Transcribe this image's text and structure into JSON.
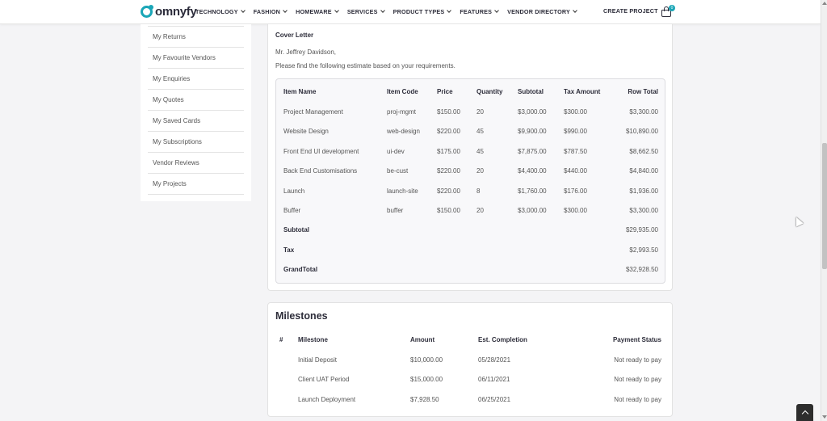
{
  "brand": {
    "name": "omnyfy",
    "accent": "#1aa6b7"
  },
  "nav": {
    "items": [
      "TECHNOLOGY",
      "FASHION",
      "HOMEWARE",
      "SERVICES",
      "PRODUCT TYPES",
      "FEATURES",
      "VENDOR DIRECTORY"
    ],
    "create_project": "CREATE PROJECT",
    "cart_count": "0"
  },
  "sidebar": {
    "items": [
      "My Returns",
      "My Favourite Vendors",
      "My Enquiries",
      "My Quotes",
      "My Saved Cards",
      "My Subscriptions",
      "Vendor Reviews",
      "My Projects"
    ]
  },
  "cover": {
    "title": "Cover Letter",
    "salutation": "Mr. Jeffrey Davidson,",
    "body": "Please find the following estimate based on your requirements."
  },
  "estimate": {
    "headers": [
      "Item Name",
      "Item Code",
      "Price",
      "Quantity",
      "Subtotal",
      "Tax Amount",
      "Row Total"
    ],
    "rows": [
      [
        "Project Management",
        "proj-mgmt",
        "$150.00",
        "20",
        "$3,000.00",
        "$300.00",
        "$3,300.00"
      ],
      [
        "Website Design",
        "web-design",
        "$220.00",
        "45",
        "$9,900.00",
        "$990.00",
        "$10,890.00"
      ],
      [
        "Front End UI development",
        "ui-dev",
        "$175.00",
        "45",
        "$7,875.00",
        "$787.50",
        "$8,662.50"
      ],
      [
        "Back End Customisations",
        "be-cust",
        "$220.00",
        "20",
        "$4,400.00",
        "$440.00",
        "$4,840.00"
      ],
      [
        "Launch",
        "launch-site",
        "$220.00",
        "8",
        "$1,760.00",
        "$176.00",
        "$1,936.00"
      ],
      [
        "Buffer",
        "buffer",
        "$150.00",
        "20",
        "$3,000.00",
        "$300.00",
        "$3,300.00"
      ]
    ],
    "totals": [
      {
        "label": "Subtotal",
        "value": "$29,935.00"
      },
      {
        "label": "Tax",
        "value": "$2,993.50"
      },
      {
        "label": "GrandTotal",
        "value": "$32,928.50"
      }
    ]
  },
  "milestones": {
    "title": "Milestones",
    "headers": [
      "#",
      "Milestone",
      "Amount",
      "Est. Completion",
      "Payment Status"
    ],
    "rows": [
      [
        "Initial Deposit",
        "$10,000.00",
        "05/28/2021",
        "Not ready to pay"
      ],
      [
        "Client UAT Period",
        "$15,000.00",
        "06/11/2021",
        "Not ready to pay"
      ],
      [
        "Launch Deployment",
        "$7,928.50",
        "06/25/2021",
        "Not ready to pay"
      ]
    ]
  }
}
